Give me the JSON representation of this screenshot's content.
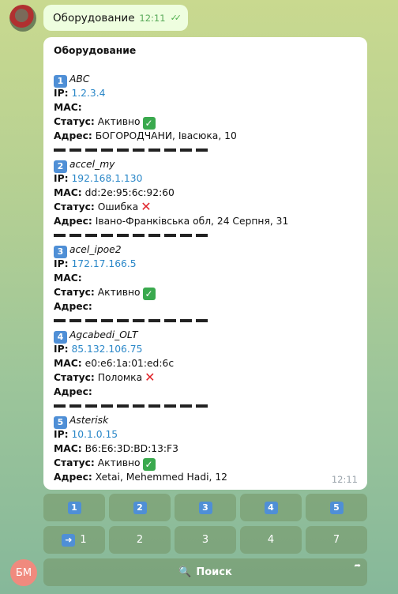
{
  "user_message": {
    "text": "Оборудование",
    "time": "12:11"
  },
  "card": {
    "title": "Оборудование",
    "time": "12:11",
    "labels": {
      "ip": "IP:",
      "mac": "MAC:",
      "status": "Статус:",
      "address": "Адрес:"
    },
    "items": [
      {
        "num": "1",
        "name": "ABC",
        "ip": "1.2.3.4",
        "mac": "",
        "status": "Активно",
        "status_ok": true,
        "address": "БОГОРОДЧАНИ, Івасюка, 10"
      },
      {
        "num": "2",
        "name": "accel_my",
        "ip": "192.168.1.130",
        "mac": "dd:2e:95:6c:92:60",
        "status": "Ошибка",
        "status_ok": false,
        "address": "Івано-Франківська обл, 24 Серпня, 31"
      },
      {
        "num": "3",
        "name": "acel_ipoe2",
        "ip": "172.17.166.5",
        "mac": "",
        "status": "Активно",
        "status_ok": true,
        "address": ""
      },
      {
        "num": "4",
        "name": "Agcabedi_OLT",
        "ip": "85.132.106.75",
        "mac": "e0:e6:1a:01:ed:6c",
        "status": "Поломка",
        "status_ok": false,
        "address": ""
      },
      {
        "num": "5",
        "name": "Asterisk",
        "ip": "10.1.0.15",
        "mac": "B6:E6:3D:BD:13:F3",
        "status": "Активно",
        "status_ok": true,
        "address": "Xetai, Mehemmed Hadi, 12"
      }
    ]
  },
  "keyboard": {
    "row1": [
      "1",
      "2",
      "3",
      "4",
      "5"
    ],
    "row2": [
      "1",
      "2",
      "3",
      "4",
      "7"
    ],
    "search_label": "Поиск"
  },
  "avatar_initials": "БМ",
  "colors": {
    "ip_link": "#2a87c8",
    "ok": "#3aa94e",
    "error": "#e0242a",
    "keycap": "#4f8fd6"
  }
}
